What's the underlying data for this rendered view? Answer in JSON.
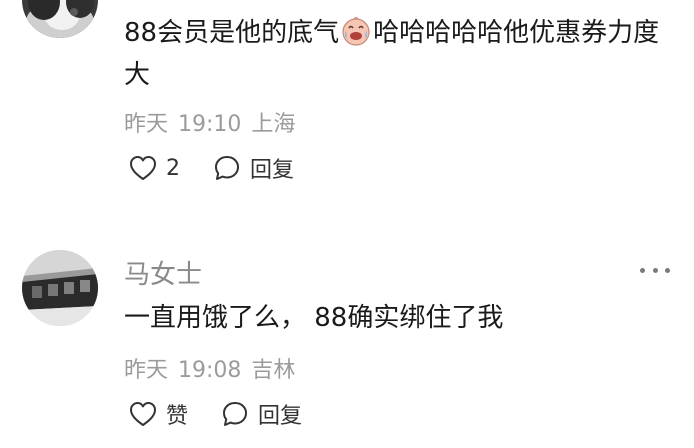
{
  "comments": [
    {
      "text_before_emoji": "88会员是他的底气",
      "emoji": "crying-laughing-face-emoji",
      "text_after_emoji": "哈哈哈哈哈他优惠券力度大",
      "date": "昨天",
      "time": "19:10",
      "location": "上海",
      "like_count": "2",
      "reply_label": "回复"
    },
    {
      "username": "马女士",
      "text": "一直用饿了么， 88确实绑住了我",
      "date": "昨天",
      "time": "19:08",
      "location": "吉林",
      "like_label": "赞",
      "reply_label": "回复"
    }
  ],
  "colors": {
    "username": "#8a8a8a",
    "meta": "#9b9b9b",
    "text": "#1a1a1a",
    "icon": "#333333"
  }
}
